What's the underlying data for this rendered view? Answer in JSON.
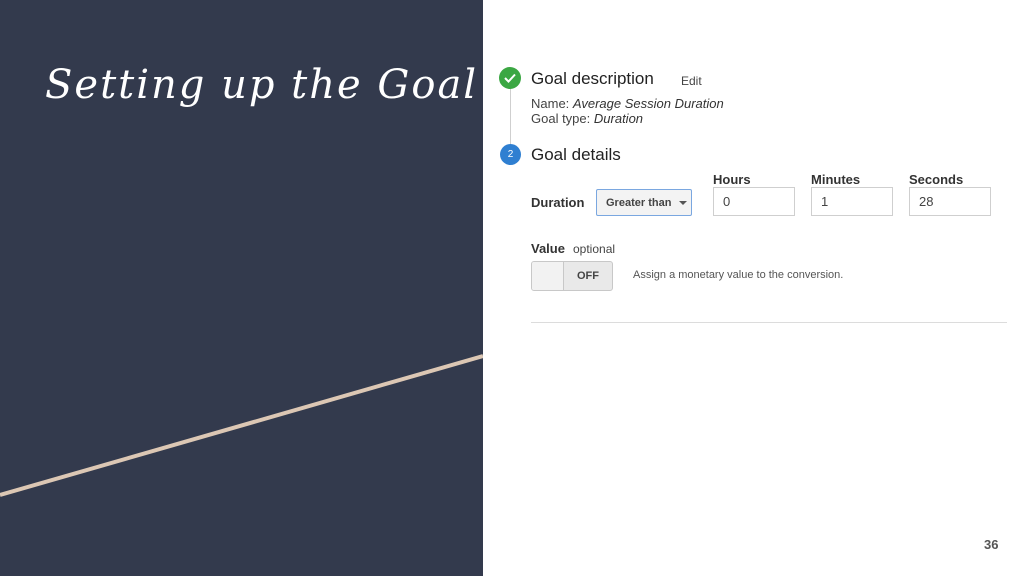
{
  "slide": {
    "title": "Setting up the Goal",
    "page_number": "36",
    "colors": {
      "left_panel_bg": "#333a4d",
      "accent_line": "#dcc7b4",
      "step_complete": "#3ba743",
      "step_active": "#2f7fd1"
    }
  },
  "goal_description": {
    "title": "Goal description",
    "edit_label": "Edit",
    "status_icon": "check-icon",
    "name_label": "Name:",
    "name_value": "Average Session Duration",
    "type_label": "Goal type:",
    "type_value": "Duration"
  },
  "goal_details": {
    "step_number": "2",
    "title": "Goal details",
    "duration_label": "Duration",
    "comparison_selected": "Greater than",
    "fields": [
      {
        "label": "Hours",
        "value": "0"
      },
      {
        "label": "Minutes",
        "value": "1"
      },
      {
        "label": "Seconds",
        "value": "28"
      }
    ],
    "value_label": "Value",
    "optional_label": "optional",
    "toggle_state": "OFF",
    "assign_text": "Assign a monetary value to the conversion."
  }
}
